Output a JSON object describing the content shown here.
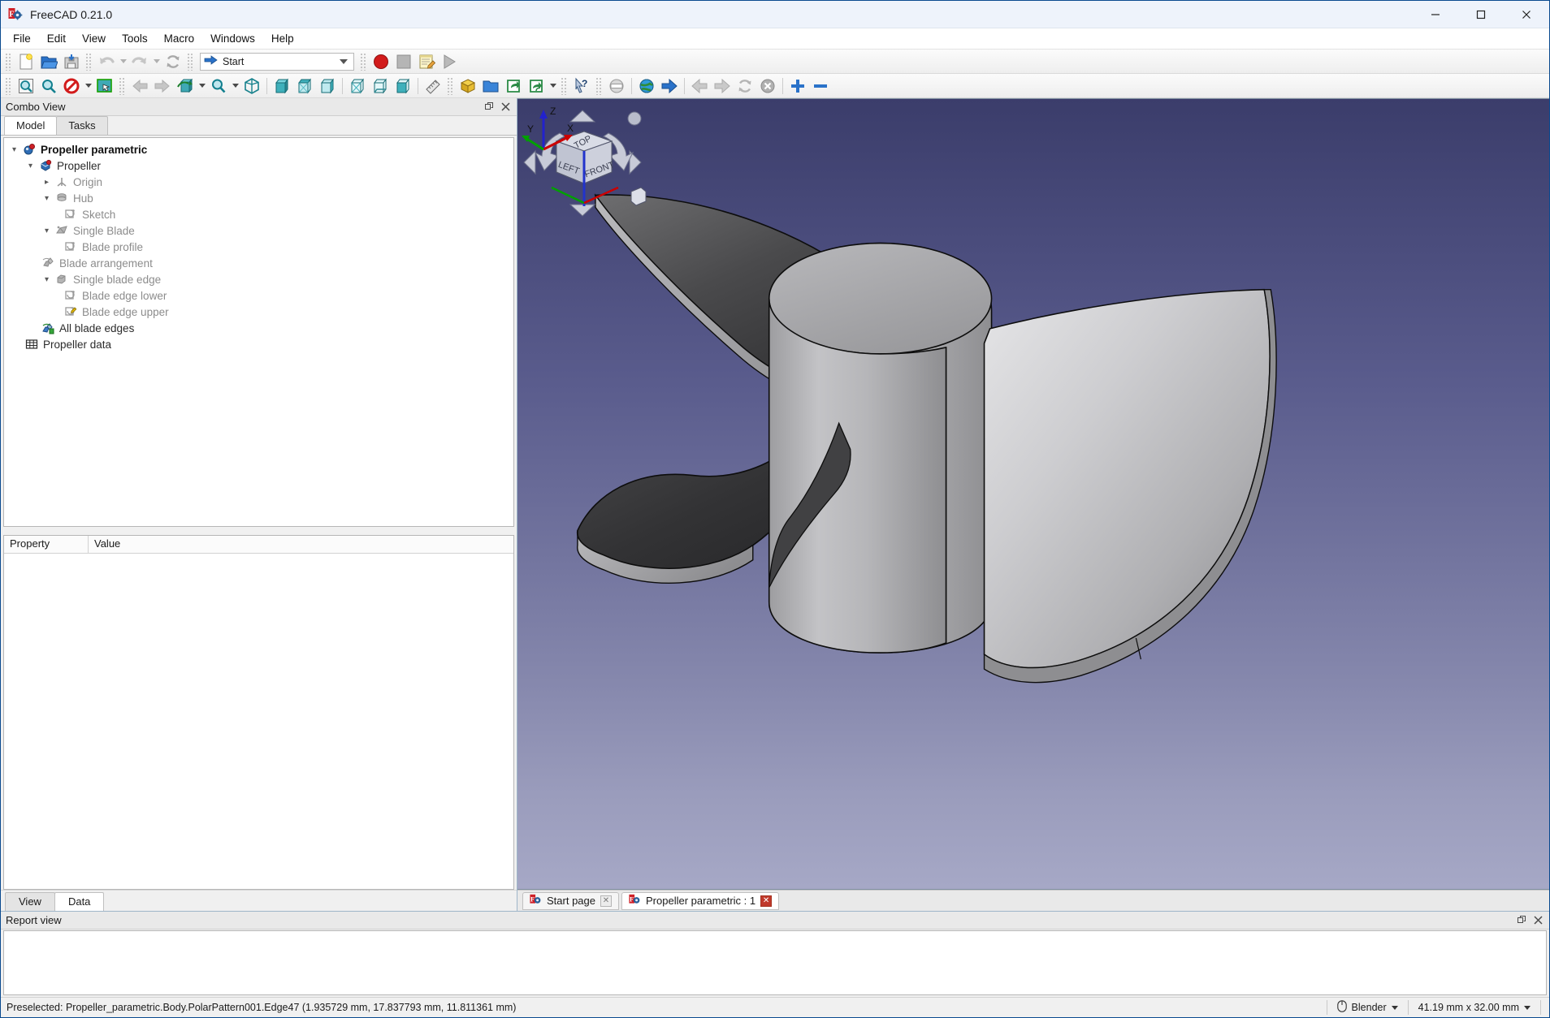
{
  "window": {
    "title": "FreeCAD 0.21.0",
    "app_icon": "freecad-logo-icon",
    "minimize": "–",
    "maximize": "▢",
    "close": "✕"
  },
  "menubar": {
    "items": [
      {
        "label": "File",
        "name": "menu-file"
      },
      {
        "label": "Edit",
        "name": "menu-edit"
      },
      {
        "label": "View",
        "name": "menu-view"
      },
      {
        "label": "Tools",
        "name": "menu-tools"
      },
      {
        "label": "Macro",
        "name": "menu-macro"
      },
      {
        "label": "Windows",
        "name": "menu-windows"
      },
      {
        "label": "Help",
        "name": "menu-help"
      }
    ]
  },
  "toolbar_file": {
    "new_label": "New",
    "open_label": "Open",
    "save_label": "Save",
    "undo_label": "Undo",
    "redo_label": "Redo",
    "refresh_label": "Refresh"
  },
  "workbench": {
    "selected": "Start",
    "label": "Workbench selector",
    "options": [
      "Start"
    ]
  },
  "toolbar_macro": {
    "record_label": "Macro recording",
    "stop_label": "Stop macro recording",
    "edit_label": "Macros",
    "execute_label": "Execute macro"
  },
  "toolbar_view": {
    "fit_all": "Fit all",
    "fit_selection": "Fit selection",
    "draw_style": "Draw style",
    "box_selection": "Box selection",
    "back": "Back",
    "forward": "Forward",
    "std_views": "Standard views",
    "zoom": "Zoom",
    "axonometric": "Isometric",
    "front": "Front",
    "top": "Top",
    "right": "Right",
    "rear": "Rear",
    "bottom": "Bottom",
    "left": "Left",
    "measure": "Measure"
  },
  "toolbar_structure": {
    "create_part": "Create part",
    "create_group": "Create group",
    "link": "Make link",
    "link_group": "Make sub-link",
    "whats_this": "What's this?"
  },
  "toolbar_start": {
    "load_start": "Start page",
    "web_home": "Load web page",
    "go": "Go",
    "previous": "Previous page",
    "next": "Next page",
    "reload": "Refresh page",
    "stop": "Stop loading",
    "zoom_in": "Zoom in",
    "zoom_out": "Zoom out"
  },
  "combo_view": {
    "title": "Combo View",
    "float_btn": "undock",
    "close_btn": "close",
    "tabs": [
      {
        "label": "Model",
        "name": "tab-model",
        "active": true
      },
      {
        "label": "Tasks",
        "name": "tab-tasks",
        "active": false
      }
    ],
    "tree": [
      {
        "label": "Propeller parametric",
        "indent": 0,
        "twisty": "expanded",
        "icon": "document-icon",
        "style": "strong"
      },
      {
        "label": "Propeller",
        "indent": 1,
        "twisty": "expanded",
        "icon": "body-icon",
        "style": "dark"
      },
      {
        "label": "Origin",
        "indent": 2,
        "twisty": "collapsed",
        "icon": "origin-icon",
        "style": "dim"
      },
      {
        "label": "Hub",
        "indent": 2,
        "twisty": "expanded",
        "icon": "pad-icon",
        "style": "dim"
      },
      {
        "label": "Sketch",
        "indent": 3,
        "twisty": "none",
        "icon": "sketch-icon",
        "style": "dim"
      },
      {
        "label": "Single Blade",
        "indent": 2,
        "twisty": "expanded",
        "icon": "additive-loft-icon",
        "style": "dim"
      },
      {
        "label": "Blade profile",
        "indent": 3,
        "twisty": "none",
        "icon": "sketch-icon",
        "style": "dim"
      },
      {
        "label": "Blade arrangement",
        "indent": 2,
        "twisty": "none",
        "icon": "polar-pattern-icon",
        "style": "dim"
      },
      {
        "label": "Single blade edge",
        "indent": 2,
        "twisty": "expanded",
        "icon": "additive-pipe-icon",
        "style": "dim"
      },
      {
        "label": "Blade edge lower",
        "indent": 3,
        "twisty": "none",
        "icon": "sketch-icon",
        "style": "dim"
      },
      {
        "label": "Blade edge upper",
        "indent": 3,
        "twisty": "none",
        "icon": "sketch-edit-icon",
        "style": "dim"
      },
      {
        "label": "All blade edges",
        "indent": 2,
        "twisty": "none",
        "icon": "polar-pattern-color-icon",
        "style": "dark"
      },
      {
        "label": "Propeller data",
        "indent": 1,
        "twisty": "none",
        "icon": "spreadsheet-icon",
        "style": "dark"
      }
    ],
    "property_editor": {
      "columns": [
        "Property",
        "Value"
      ],
      "rows": []
    },
    "bottom_tabs": [
      {
        "label": "View",
        "name": "tab-view",
        "active": false
      },
      {
        "label": "Data",
        "name": "tab-data",
        "active": true
      }
    ]
  },
  "view3d": {
    "navigation_cube": {
      "top": "TOP",
      "left": "LEFT",
      "front": "FRONT"
    },
    "axis_cross": {
      "x": "X",
      "y": "Y",
      "z": "Z"
    },
    "colors": {
      "bg_top": "#3b3d6b",
      "bg_bottom": "#a6a8c6",
      "face_light": "#c9c9cb",
      "face_mid": "#9a9a9c",
      "face_dark": "#3a3a3c",
      "edge": "#101010",
      "axis_x": "#cc0000",
      "axis_y": "#00a000",
      "axis_z": "#2222cc"
    }
  },
  "document_tabs": [
    {
      "label": "Start page",
      "name": "doc-tab-start-page",
      "active": false,
      "icon": "freecad-logo-icon",
      "close": "✕"
    },
    {
      "label": "Propeller parametric : 1",
      "name": "doc-tab-propeller",
      "active": true,
      "icon": "freecad-logo-icon",
      "close": "✕"
    }
  ],
  "report_view": {
    "title": "Report view",
    "float_btn": "undock",
    "close_btn": "close",
    "lines": []
  },
  "statusbar": {
    "message": "Preselected: Propeller_parametric.Body.PolarPattern001.Edge47 (1.935729 mm, 17.837793 mm, 11.811361 mm)",
    "navigation_style": "Blender",
    "navigation_icon": "mouse-icon",
    "dimensions": "41.19 mm x 32.00 mm"
  }
}
